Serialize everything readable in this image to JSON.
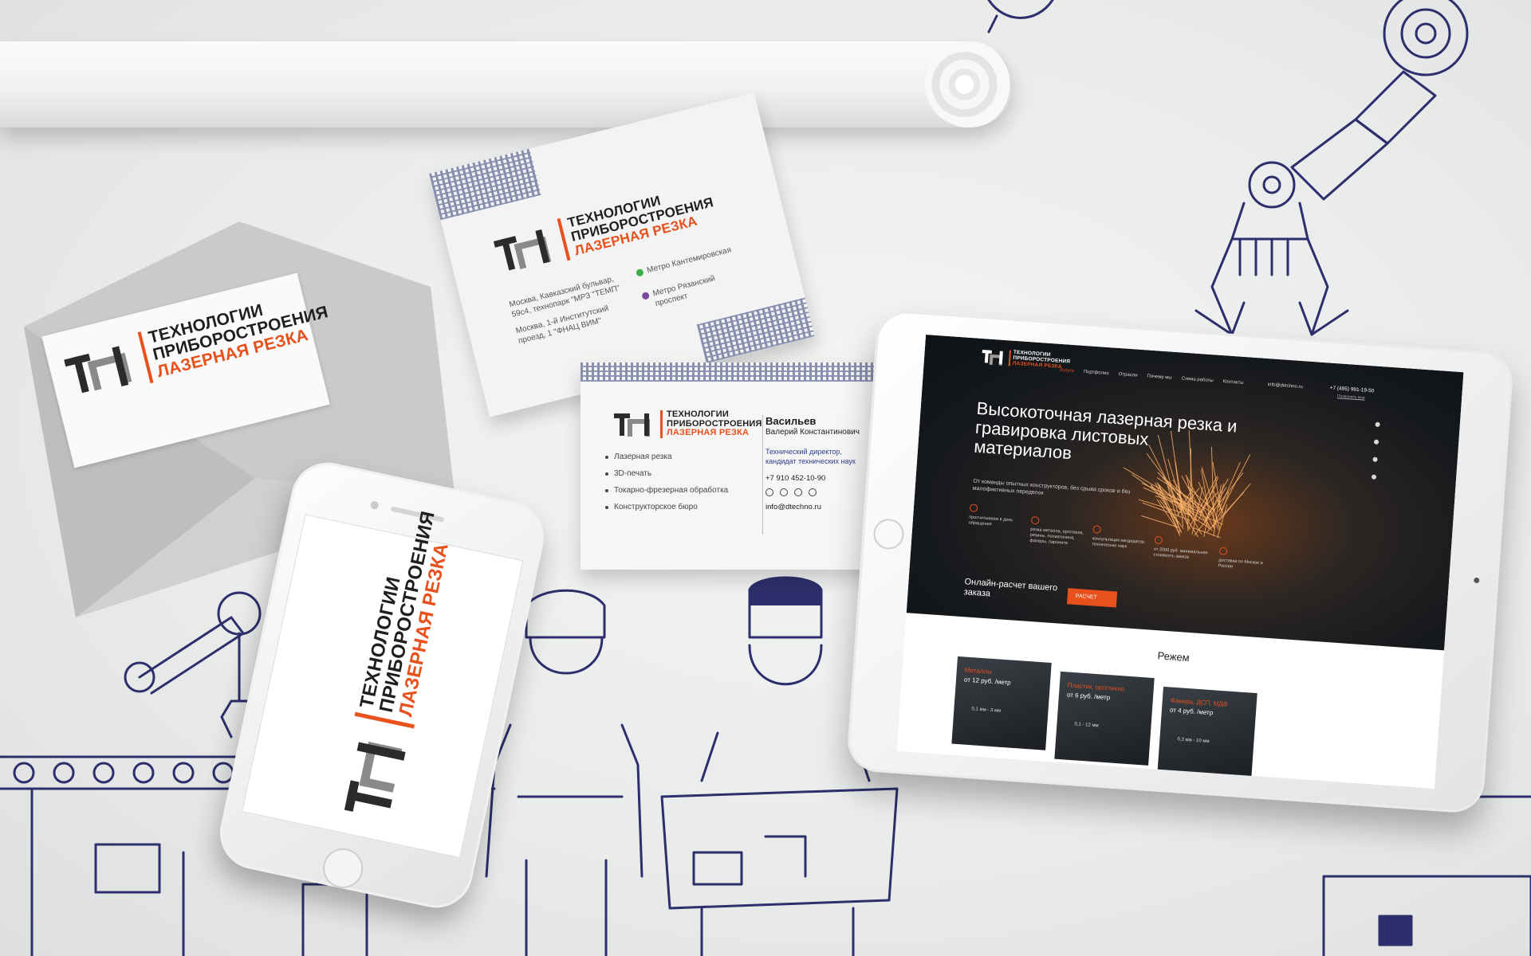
{
  "brand": {
    "line1": "ТЕХНОЛОГИИ",
    "line2": "ПРИБОРОСТРОЕНИЯ",
    "line3": "ЛАЗЕРНАЯ РЕЗКА",
    "accent": "#e8501c",
    "ink": "#2b2b2b"
  },
  "card_front": {
    "address1": "Москва, Кавказский бульвар, 59с4, технопарк \"МРЗ \"ТЕМП\"",
    "address2": "Москва, 1-й Институтский проезд, 1 \"ФНАЦ ВИМ\"",
    "metro1": "Метро Кантемировская",
    "metro2": "Метро Рязанский проспект"
  },
  "card_back": {
    "surname": "Васильев",
    "name": "Валерий Константинович",
    "title": "Технический директор, кандидат технических наук",
    "phone": "+7 910 452-10-90",
    "email": "info@dtechno.ru",
    "services": [
      "Лазерная резка",
      "3D-печать",
      "Токарно-фрезерная обработка",
      "Конструкторское бюро"
    ]
  },
  "website": {
    "nav": [
      "Услуги",
      "Портфолио",
      "Отрасли",
      "Почему мы",
      "Схема работы",
      "Контакты"
    ],
    "email": "info@dtechno.ru",
    "phone": "+7 (495) 991-19-50",
    "callback": "Позвонить мне",
    "hero_title": "Высокоточная лазерная резка и гравировка листовых материалов",
    "hero_sub": "От команды опытных конструкторов, без срыва сроков и без малофиктивных переделок",
    "features": [
      "просчитываем в день обращения",
      "резка металла, оргстекла, резины, полиэтилена, фанеры, паронита",
      "консультация кандидатов технических наук",
      "от 2000 руб. минимальная стоимость заказа",
      "доставка по Москве и России"
    ],
    "calc_text": "Онлайн-расчет вашего заказа",
    "calc_button": "РАСЧЕТ",
    "section_title": "Режем",
    "tiles": [
      {
        "name": "Металлы",
        "price": "от 12 руб. /метр",
        "range": "0,1 мм - 3 мм"
      },
      {
        "name": "Пластик, оргстекло",
        "price": "от 6 руб. /метр",
        "range": "0,1 - 12 мм"
      },
      {
        "name": "Фанера, ДСП, МДФ",
        "price": "от 4 руб. /метр",
        "range": "0,3 мм - 10 мм"
      }
    ]
  }
}
